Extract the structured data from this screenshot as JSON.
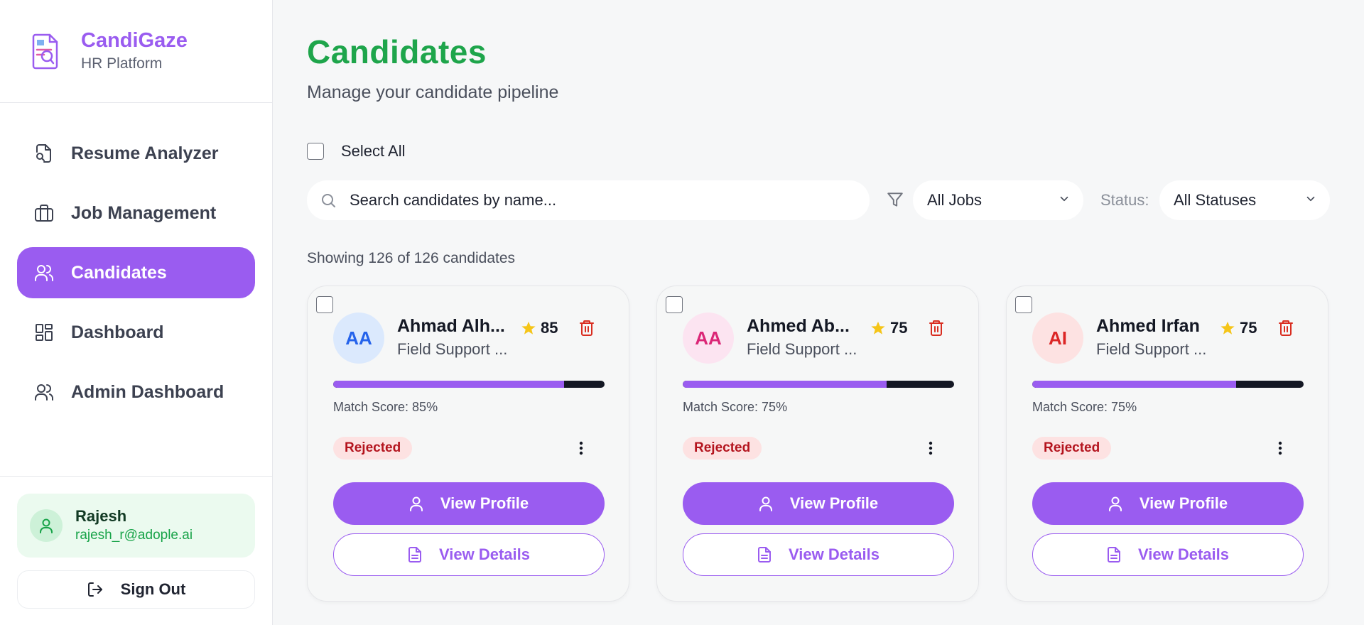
{
  "brand": {
    "title": "CandiGaze",
    "subtitle": "HR Platform"
  },
  "nav": {
    "items": [
      {
        "label": "Resume Analyzer",
        "icon": "file-search-icon",
        "active": false
      },
      {
        "label": "Job Management",
        "icon": "briefcase-icon",
        "active": false
      },
      {
        "label": "Candidates",
        "icon": "users-icon",
        "active": true
      },
      {
        "label": "Dashboard",
        "icon": "dashboard-grid-icon",
        "active": false
      },
      {
        "label": "Admin Dashboard",
        "icon": "users-icon",
        "active": false
      }
    ]
  },
  "user": {
    "name": "Rajesh",
    "email": "rajesh_r@adople.ai"
  },
  "signout_label": "Sign Out",
  "page": {
    "title": "Candidates",
    "subtitle": "Manage your candidate pipeline"
  },
  "select_all_label": "Select All",
  "search": {
    "placeholder": "Search candidates by name..."
  },
  "filters": {
    "jobs_value": "All Jobs",
    "status_label": "Status:",
    "status_value": "All Statuses"
  },
  "count_text": "Showing 126 of 126 candidates",
  "colors": {
    "accent": "#9a5cf0",
    "title_green": "#1ea54b",
    "rejected_bg": "#fde2e2",
    "rejected_text": "#b4141e",
    "star": "#f5c518",
    "trash": "#d92d20"
  },
  "candidates": [
    {
      "initials": "AA",
      "name": "Ahmad Alh...",
      "role": "Field Support ...",
      "rating": "85",
      "match_score_text": "Match Score: 85%",
      "match_score": 0.85,
      "status": "Rejected",
      "avatar_bg": "#dbe9fd",
      "avatar_fg": "#2563eb",
      "view_profile_label": "View Profile",
      "view_details_label": "View Details"
    },
    {
      "initials": "AA",
      "name": "Ahmed Ab...",
      "role": "Field Support ...",
      "rating": "75",
      "match_score_text": "Match Score: 75%",
      "match_score": 0.75,
      "status": "Rejected",
      "avatar_bg": "#fce4f1",
      "avatar_fg": "#db2777",
      "view_profile_label": "View Profile",
      "view_details_label": "View Details"
    },
    {
      "initials": "AI",
      "name": "Ahmed Irfan",
      "role": "Field Support ...",
      "rating": "75",
      "match_score_text": "Match Score: 75%",
      "match_score": 0.75,
      "status": "Rejected",
      "avatar_bg": "#fde2e2",
      "avatar_fg": "#dc2626",
      "view_profile_label": "View Profile",
      "view_details_label": "View Details"
    }
  ]
}
